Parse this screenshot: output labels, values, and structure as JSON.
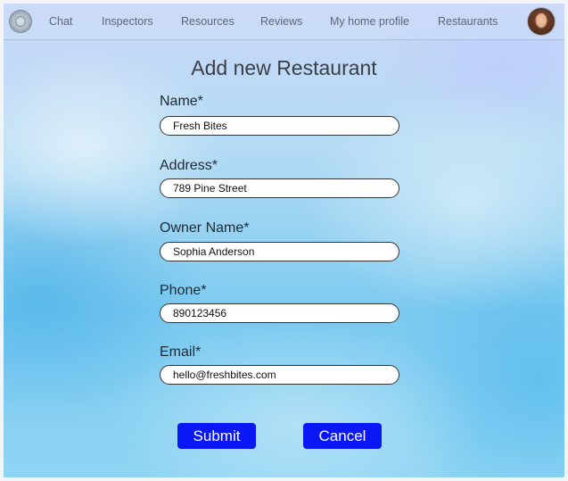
{
  "nav": {
    "logo": "logo-icon",
    "items": [
      {
        "label": "Chat"
      },
      {
        "label": "Inspectors"
      },
      {
        "label": "Resources"
      },
      {
        "label": "Reviews"
      },
      {
        "label": "My home profile"
      },
      {
        "label": "Restaurants"
      }
    ],
    "avatar": "user-avatar"
  },
  "form": {
    "title": "Add new Restaurant",
    "fields": [
      {
        "label": "Name*",
        "value": "Fresh Bites"
      },
      {
        "label": "Address*",
        "value": "789 Pine Street"
      },
      {
        "label": "Owner Name*",
        "value": "Sophia Anderson"
      },
      {
        "label": "Phone*",
        "value": "890123456"
      },
      {
        "label": "Email*",
        "value": "hello@freshbites.com"
      }
    ],
    "submit_label": "Submit",
    "cancel_label": "Cancel"
  },
  "colors": {
    "button_bg": "#0a18f5",
    "button_text": "#ffffff"
  }
}
